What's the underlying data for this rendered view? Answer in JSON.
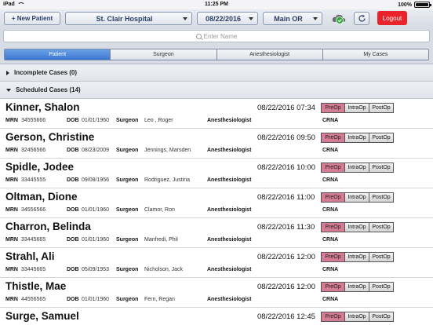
{
  "status_bar": {
    "carrier": "iPad",
    "time": "11:25 PM",
    "battery": "100%"
  },
  "toolbar": {
    "new_patient_label": "+ New Patient",
    "hospital": "St. Clair Hospital",
    "date": "08/22/2016",
    "location": "Main OR",
    "logout_label": "Logout",
    "accent_color": "#e8232b"
  },
  "search": {
    "placeholder": "Enter Name"
  },
  "tabs": [
    "Patient",
    "Surgeon",
    "Anesthesiologist",
    "My Cases"
  ],
  "active_tab": "Patient",
  "sections": {
    "incomplete": "Incomplete Cases (0)",
    "scheduled": "Scheduled Cases (14)"
  },
  "labels": {
    "mrn": "MRN",
    "dob": "DOB",
    "surgeon": "Surgeon",
    "anesthesiologist": "Anesthesiologist",
    "crna": "CRNA",
    "preop": "PreOp",
    "intraop": "IntraOp",
    "postop": "PostOp"
  },
  "cases": [
    {
      "name": "Kinner, Shalon",
      "datetime": "08/22/2016 07:34",
      "mrn": "34555666",
      "dob": "01/01/1960",
      "surgeon": "Leo , Roger"
    },
    {
      "name": "Gerson, Christine",
      "datetime": "08/22/2016 09:50",
      "mrn": "32456566",
      "dob": "08/23/2009",
      "surgeon": "Jennings, Marsden"
    },
    {
      "name": "Spidle, Jodee",
      "datetime": "08/22/2016 10:00",
      "mrn": "33445555",
      "dob": "09/08/1956",
      "surgeon": "Rodriguez, Justina"
    },
    {
      "name": "Oltman, Dione",
      "datetime": "08/22/2016 11:00",
      "mrn": "34556566",
      "dob": "01/01/1960",
      "surgeon": "Clamor, Ron"
    },
    {
      "name": "Charron, Belinda",
      "datetime": "08/22/2016 11:30",
      "mrn": "33445665",
      "dob": "01/01/1960",
      "surgeon": "Manfredi, Phil"
    },
    {
      "name": "Strahl, Ali",
      "datetime": "08/22/2016 12:00",
      "mrn": "33445665",
      "dob": "05/09/1953",
      "surgeon": "Nicholson, Jack"
    },
    {
      "name": "Thistle, Mae",
      "datetime": "08/22/2016 12:00",
      "mrn": "44556565",
      "dob": "01/01/1960",
      "surgeon": "Fern, Regan"
    },
    {
      "name": "Surge, Samuel",
      "datetime": "08/22/2016 12:45",
      "mrn": "",
      "dob": "",
      "surgeon": ""
    }
  ]
}
